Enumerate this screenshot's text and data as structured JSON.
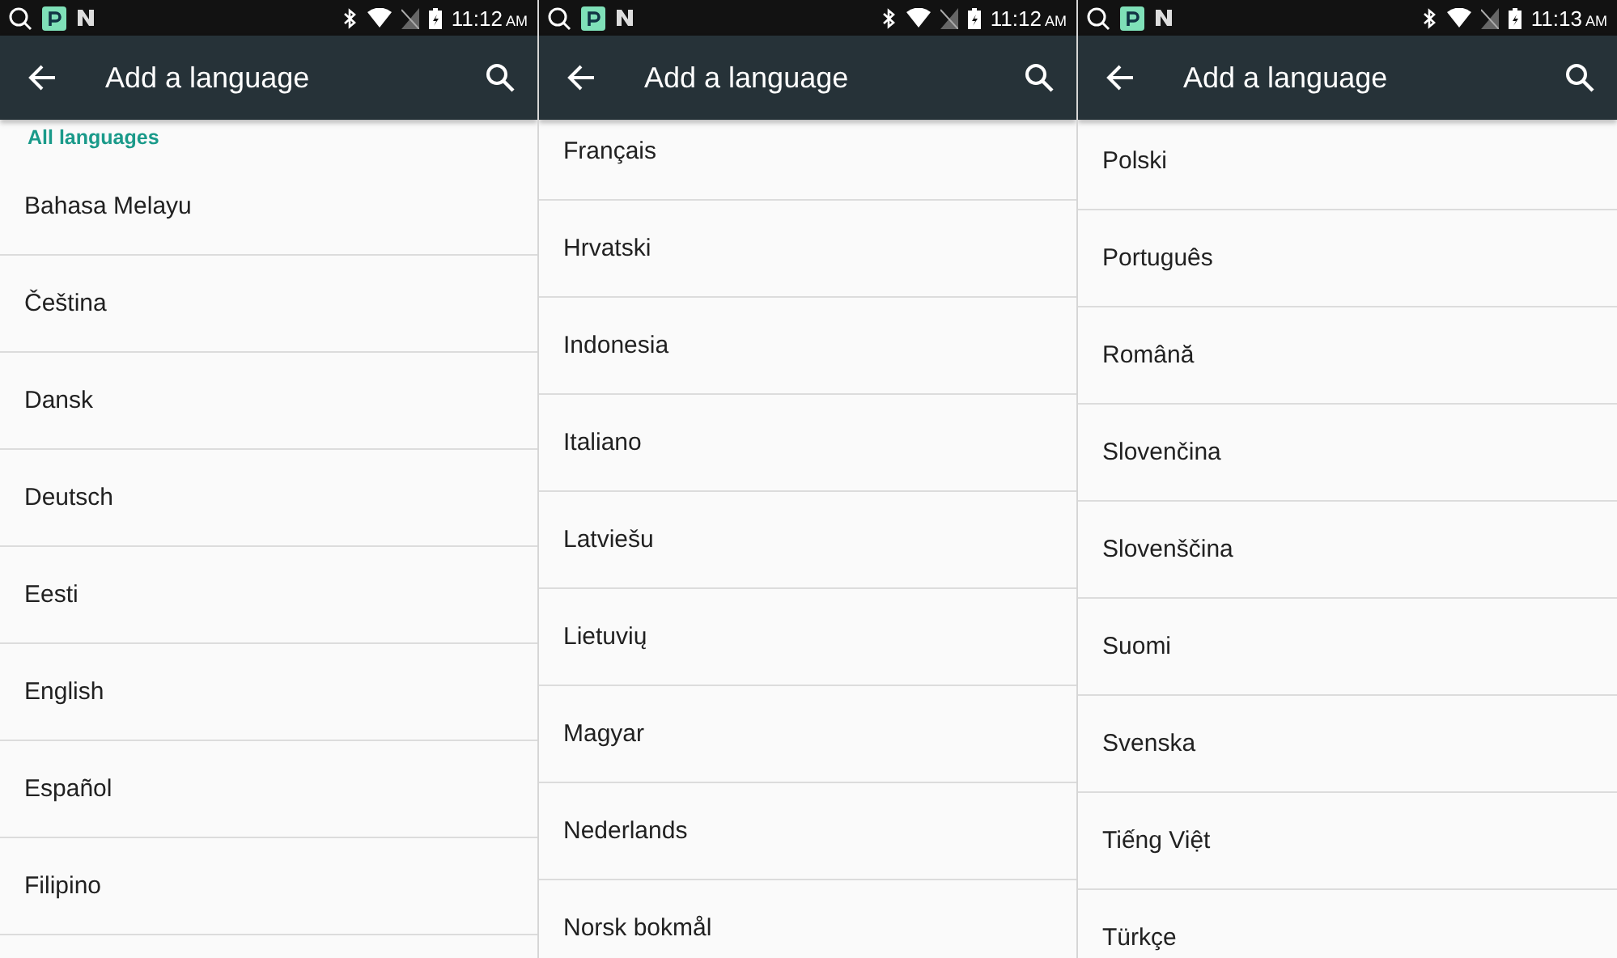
{
  "screens": [
    {
      "status_bar": {
        "time": "11:12",
        "ampm": "AM"
      },
      "app_bar": {
        "title": "Add a language"
      },
      "section_header": "All languages",
      "languages": [
        "Bahasa Melayu",
        "Čeština",
        "Dansk",
        "Deutsch",
        "Eesti",
        "English",
        "Español",
        "Filipino"
      ]
    },
    {
      "status_bar": {
        "time": "11:12",
        "ampm": "AM"
      },
      "app_bar": {
        "title": "Add a language"
      },
      "languages": [
        "Français",
        "Hrvatski",
        "Indonesia",
        "Italiano",
        "Latviešu",
        "Lietuvių",
        "Magyar",
        "Nederlands",
        "Norsk bokmål"
      ]
    },
    {
      "status_bar": {
        "time": "11:13",
        "ampm": "AM"
      },
      "app_bar": {
        "title": "Add a language"
      },
      "languages": [
        "Polski",
        "Português",
        "Română",
        "Slovenčina",
        "Slovenščina",
        "Suomi",
        "Svenska",
        "Tiếng Việt",
        "Türkçe"
      ]
    }
  ]
}
